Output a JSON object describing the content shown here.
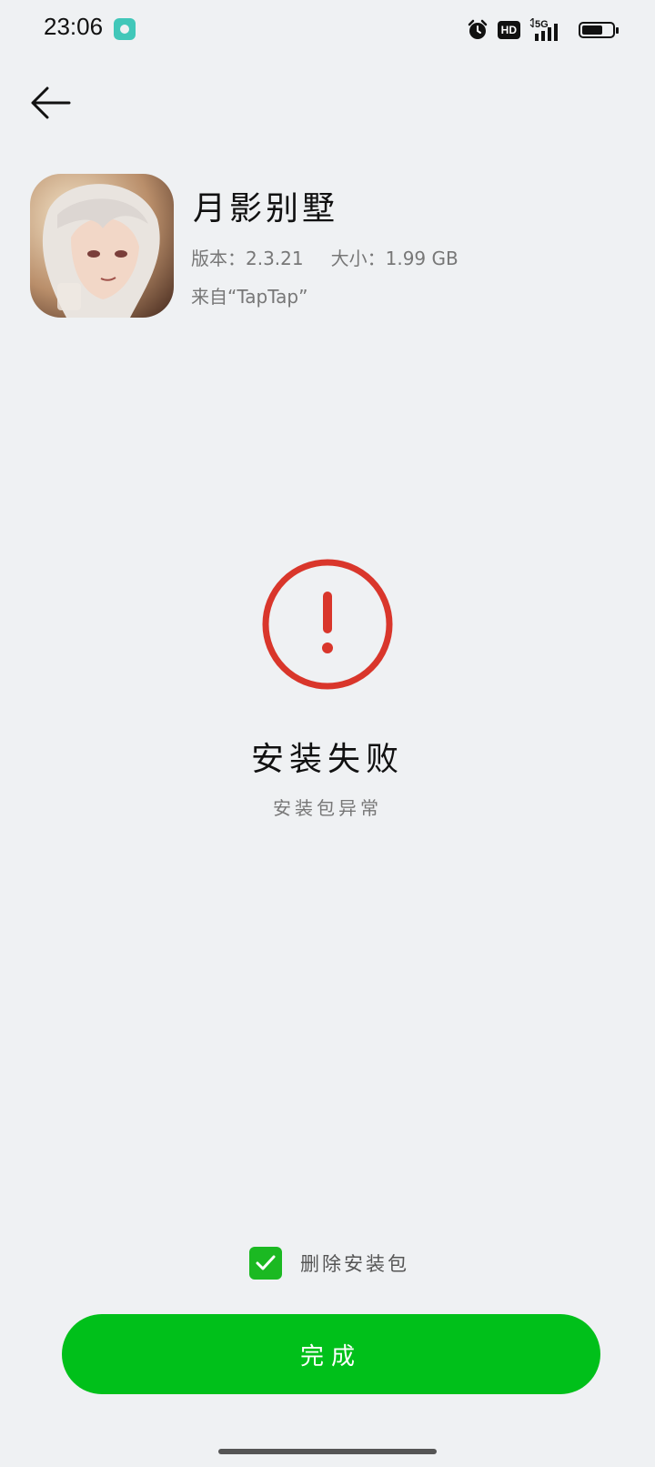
{
  "status_bar": {
    "time": "23:06",
    "network_label": "5G",
    "hd_label": "HD"
  },
  "app": {
    "name": "月影别墅",
    "version": "版本：2.3.21",
    "size": "大小：1.99 GB",
    "source": "来自“TapTap”"
  },
  "result": {
    "title": "安装失败",
    "reason": "安装包异常",
    "status_color": "#d9362b"
  },
  "options": {
    "delete_package_label": "删除安装包",
    "delete_package_checked": true
  },
  "actions": {
    "done_label": "完成",
    "accent_color": "#00c01a"
  }
}
